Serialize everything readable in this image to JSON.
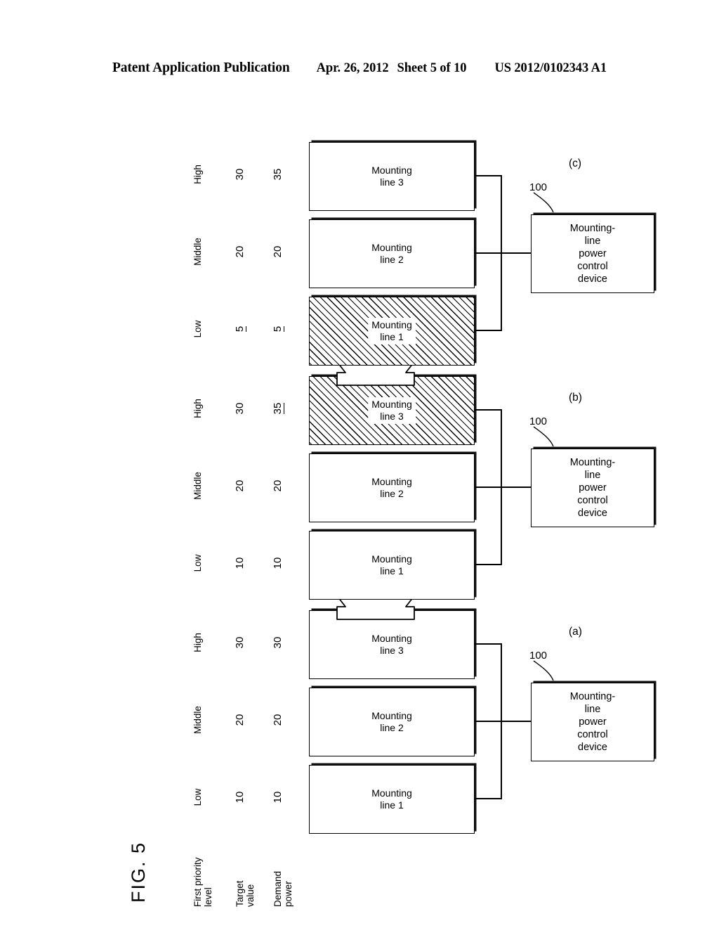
{
  "header": {
    "publication": "Patent Application Publication",
    "date": "Apr. 26, 2012",
    "sheet": "Sheet 5 of 10",
    "number": "US 2012/0102343 A1"
  },
  "figure": {
    "caption": "FIG. 5",
    "row_labels": {
      "priority": "First priority\nlevel",
      "target": "Target\nvalue",
      "demand": "Demand\npower"
    },
    "device_label": "Mounting-line\npower control\ndevice",
    "reference_numeral": "100",
    "panels": [
      {
        "letter": "(a)",
        "columns": [
          {
            "level": "Low",
            "target": "10",
            "target_underlined": false,
            "demand": "10",
            "demand_underlined": false,
            "box_label": "Mounting\nline 1",
            "hatched": false
          },
          {
            "level": "Middle",
            "target": "20",
            "target_underlined": false,
            "demand": "20",
            "demand_underlined": false,
            "box_label": "Mounting\nline 2",
            "hatched": false
          },
          {
            "level": "High",
            "target": "30",
            "target_underlined": false,
            "demand": "30",
            "demand_underlined": false,
            "box_label": "Mounting\nline 3",
            "hatched": false
          }
        ]
      },
      {
        "letter": "(b)",
        "columns": [
          {
            "level": "Low",
            "target": "10",
            "target_underlined": false,
            "demand": "10",
            "demand_underlined": false,
            "box_label": "Mounting\nline 1",
            "hatched": false
          },
          {
            "level": "Middle",
            "target": "20",
            "target_underlined": false,
            "demand": "20",
            "demand_underlined": false,
            "box_label": "Mounting\nline 2",
            "hatched": false
          },
          {
            "level": "High",
            "target": "30",
            "target_underlined": false,
            "demand": "35",
            "demand_underlined": true,
            "box_label": "Mounting\nline 3",
            "hatched": true
          }
        ]
      },
      {
        "letter": "(c)",
        "columns": [
          {
            "level": "Low",
            "target": "5",
            "target_underlined": true,
            "demand": "5",
            "demand_underlined": true,
            "box_label": "Mounting\nline 1",
            "hatched": true
          },
          {
            "level": "Middle",
            "target": "20",
            "target_underlined": false,
            "demand": "20",
            "demand_underlined": false,
            "box_label": "Mounting\nline 2",
            "hatched": false
          },
          {
            "level": "High",
            "target": "30",
            "target_underlined": false,
            "demand": "35",
            "demand_underlined": false,
            "box_label": "Mounting\nline 3",
            "hatched": false
          }
        ]
      }
    ]
  }
}
